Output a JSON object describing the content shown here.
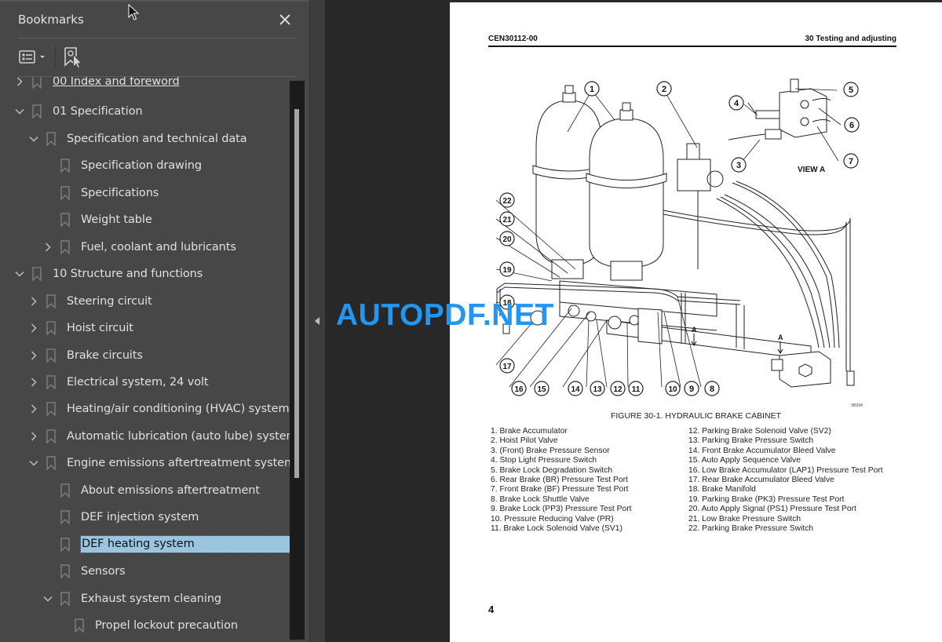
{
  "bookmarks_panel": {
    "title": "Bookmarks",
    "close_icon": "close-icon",
    "toolbar": {
      "options_icon": "list-options-icon",
      "options_dropdown_icon": "chevron-down-icon",
      "add_bookmark_icon": "bookmark-add-icon"
    },
    "items": [
      {
        "label": "00 Index and foreword",
        "level": 0,
        "expander": "collapsed",
        "partially_visible": true
      },
      {
        "label": "01 Specification",
        "level": 0,
        "expander": "expanded"
      },
      {
        "label": "Specification and technical data",
        "level": 1,
        "expander": "expanded"
      },
      {
        "label": "Specification drawing",
        "level": 2,
        "expander": "none"
      },
      {
        "label": "Specifications",
        "level": 2,
        "expander": "none"
      },
      {
        "label": "Weight table",
        "level": 2,
        "expander": "none"
      },
      {
        "label": "Fuel, coolant and lubricants",
        "level": 2,
        "expander": "collapsed"
      },
      {
        "label": "10 Structure and functions",
        "level": 0,
        "expander": "expanded"
      },
      {
        "label": "Steering circuit",
        "level": 1,
        "expander": "collapsed"
      },
      {
        "label": "Hoist circuit",
        "level": 1,
        "expander": "collapsed"
      },
      {
        "label": "Brake circuits",
        "level": 1,
        "expander": "collapsed"
      },
      {
        "label": "Electrical system, 24 volt",
        "level": 1,
        "expander": "collapsed"
      },
      {
        "label": "Heating/air conditioning (HVAC) system",
        "level": 1,
        "expander": "collapsed"
      },
      {
        "label": "Automatic lubrication (auto lube) system",
        "level": 1,
        "expander": "collapsed"
      },
      {
        "label": "Engine emissions aftertreatment system",
        "level": 1,
        "expander": "expanded"
      },
      {
        "label": "About emissions aftertreatment",
        "level": 2,
        "expander": "none"
      },
      {
        "label": "DEF injection system",
        "level": 2,
        "expander": "none"
      },
      {
        "label": "DEF heating system",
        "level": 2,
        "expander": "none",
        "selected": true
      },
      {
        "label": "Sensors",
        "level": 2,
        "expander": "none"
      },
      {
        "label": "Exhaust system cleaning",
        "level": 2,
        "expander": "expanded"
      },
      {
        "label": "Propel lockout precaution",
        "level": 3,
        "expander": "none"
      }
    ],
    "scroll": {
      "thumb_start_fraction": 0.05,
      "thumb_size_fraction": 0.66
    },
    "selection_color": "#9ac4e0"
  },
  "collapse_panel_icon": "chevron-left-icon",
  "document": {
    "header_left": "CEN30112-00",
    "header_right": "30 Testing and adjusting",
    "figure": {
      "view_label": "VIEW A",
      "section_marker": "A",
      "callouts": [
        "1",
        "2",
        "3",
        "4",
        "5",
        "6",
        "7",
        "8",
        "9",
        "10",
        "11",
        "12",
        "13",
        "14",
        "15",
        "16",
        "17",
        "18",
        "19",
        "20",
        "21",
        "22"
      ],
      "drawing_code": "85294",
      "caption": "FIGURE 30-1. HYDRAULIC BRAKE CABINET"
    },
    "legend_col1": [
      "1. Brake Accumulator",
      "2. Hoist Pilot Valve",
      "3. (Front) Brake Pressure Sensor",
      "4. Stop Light Pressure Switch",
      "5. Brake Lock Degradation Switch",
      "6. Rear Brake (BR) Pressure Test Port",
      "7. Front Brake (BF) Pressure Test Port",
      "8. Brake Lock Shuttle Valve",
      "9. Brake Lock (PP3) Pressure Test Port",
      "10. Pressure Reducing Valve (PR)",
      "11. Brake Lock Solenoid Valve (SV1)"
    ],
    "legend_col2": [
      "12. Parking Brake Solenoid Valve (SV2)",
      "13. Parking Brake Pressure Switch",
      "14. Front Brake Accumulator Bleed Valve",
      "15. Auto Apply Sequence Valve",
      "16. Low Brake Accumulator (LAP1) Pressure Test Port",
      "17. Rear Brake Accumulator Bleed Valve",
      "18. Brake Manifold",
      "19. Parking Brake (PK3) Pressure Test Port",
      "20. Auto Apply Signal (PS1) Pressure Test Port",
      "21. Low Brake Pressure Switch",
      "22. Parking Brake Pressure Switch"
    ],
    "page_number": "4"
  },
  "watermark": {
    "text": "AUTOPDF.NET",
    "color": "#2196f3"
  },
  "cursor_icon": "mouse-pointer-icon"
}
